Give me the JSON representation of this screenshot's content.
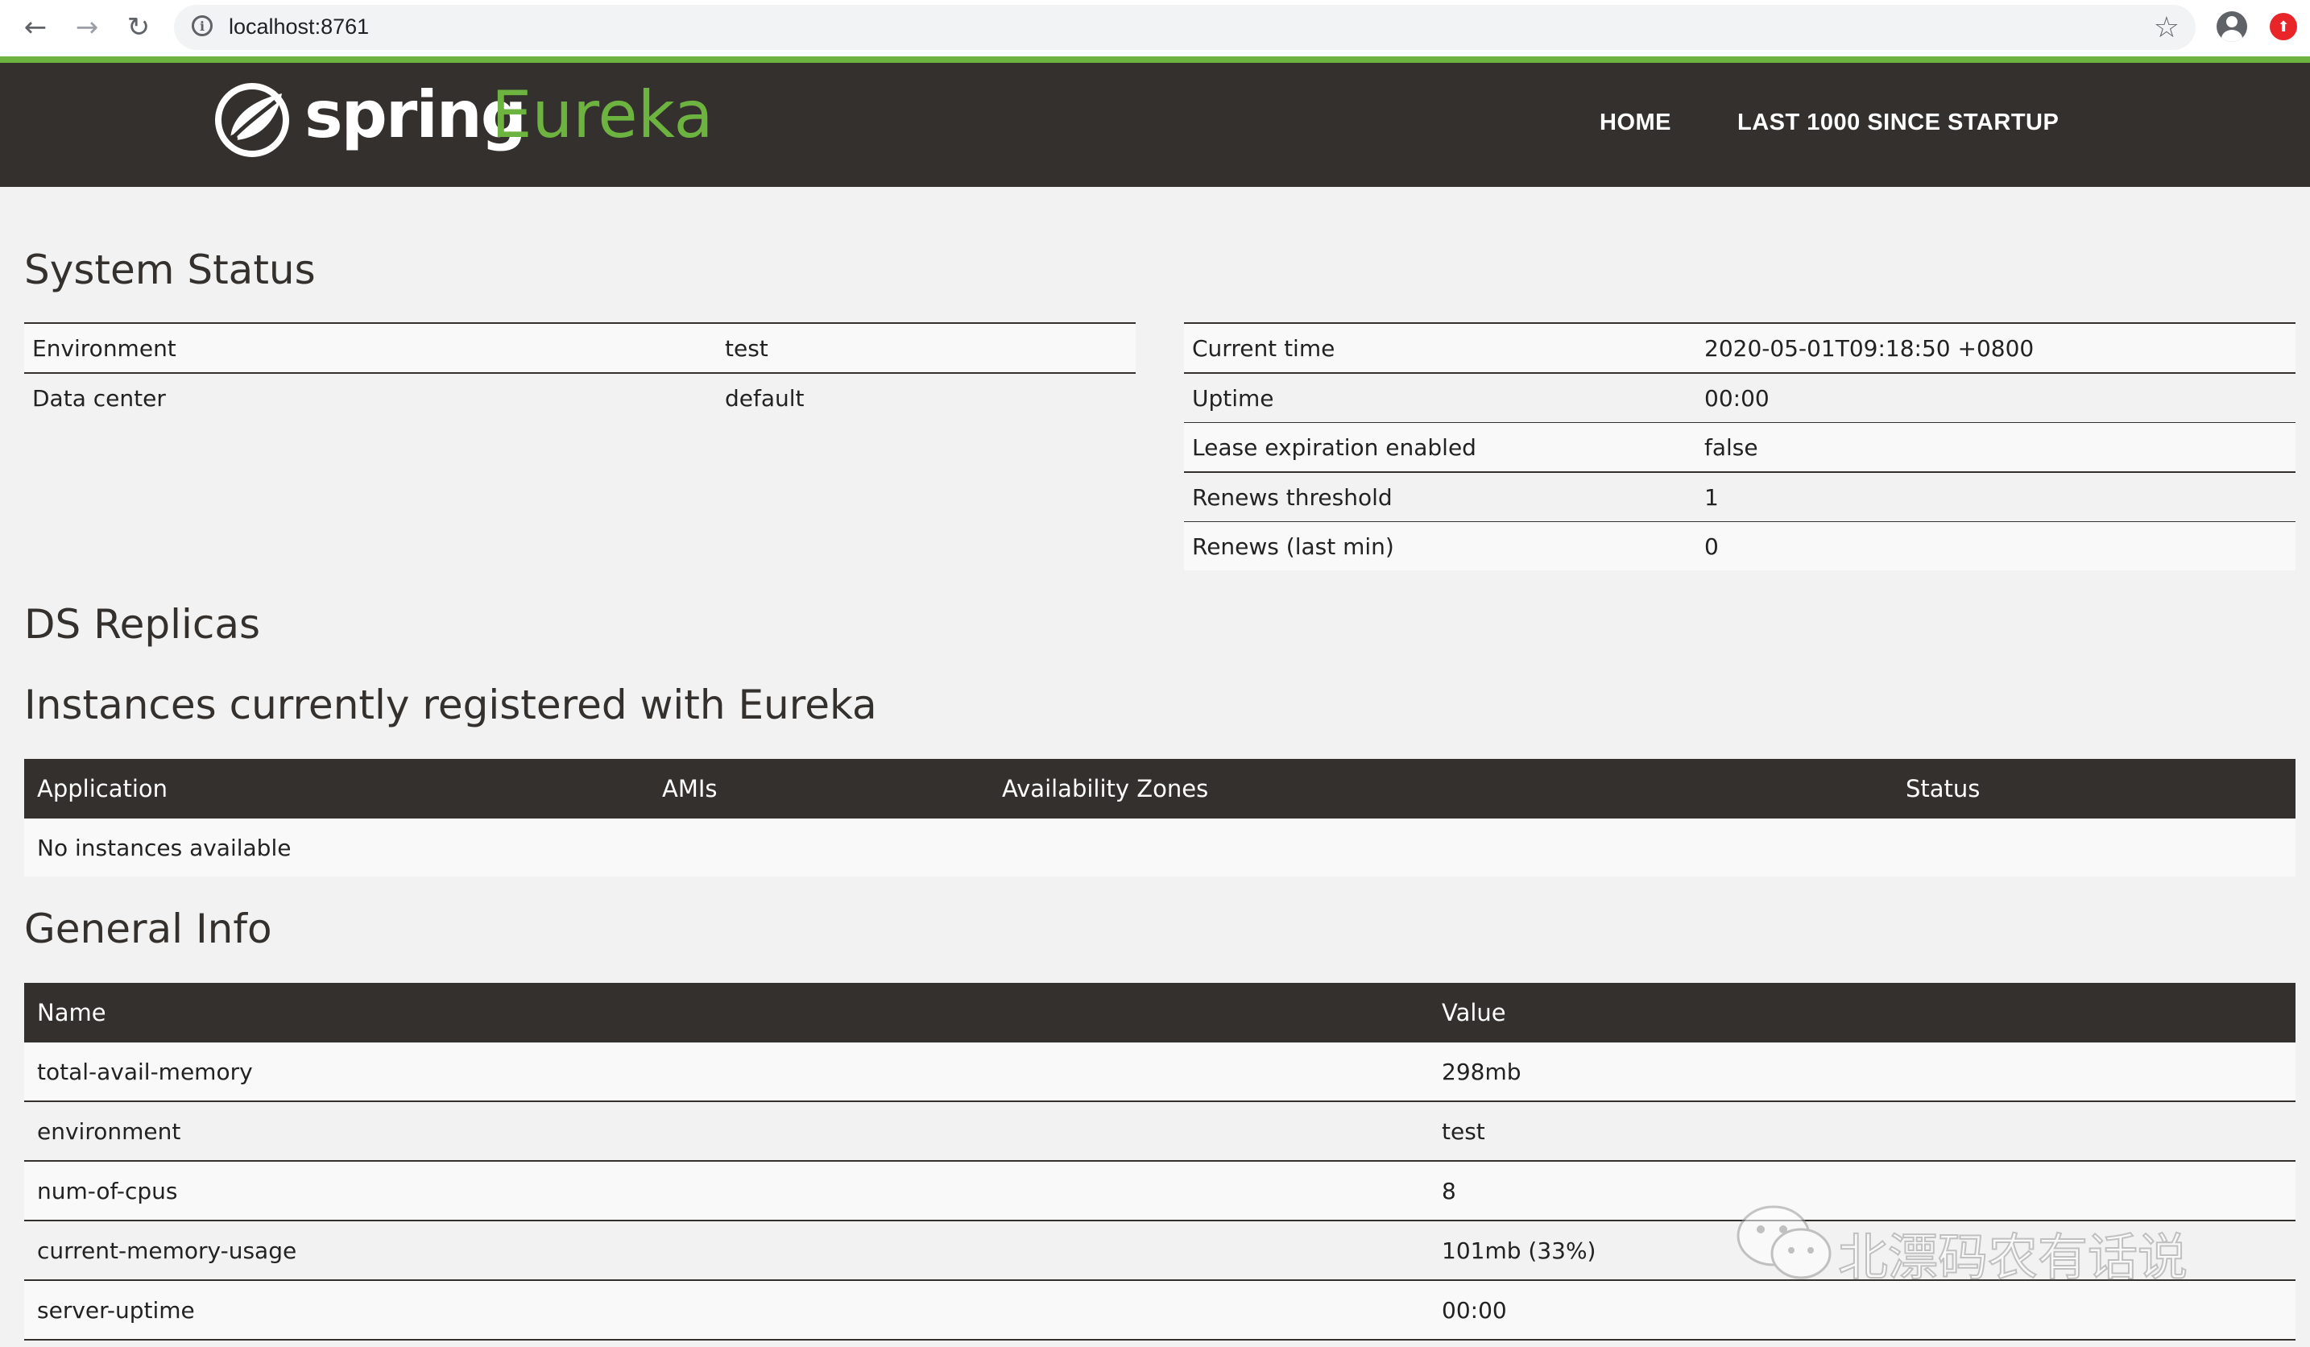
{
  "browser": {
    "url": "localhost:8761",
    "back_icon": "←",
    "forward_icon": "→",
    "reload_icon": "↻",
    "star_icon": "☆"
  },
  "header": {
    "logo_spring": "spring",
    "logo_eureka": "Eureka",
    "nav": [
      {
        "label": "HOME"
      },
      {
        "label": "LAST 1000 SINCE STARTUP"
      }
    ]
  },
  "system_status": {
    "title": "System Status",
    "left": [
      {
        "key": "Environment",
        "value": "test"
      },
      {
        "key": "Data center",
        "value": "default"
      }
    ],
    "right": [
      {
        "key": "Current time",
        "value": "2020-05-01T09:18:50 +0800"
      },
      {
        "key": "Uptime",
        "value": "00:00"
      },
      {
        "key": "Lease expiration enabled",
        "value": "false"
      },
      {
        "key": "Renews threshold",
        "value": "1"
      },
      {
        "key": "Renews (last min)",
        "value": "0"
      }
    ]
  },
  "ds_replicas": {
    "title": "DS Replicas"
  },
  "instances": {
    "title": "Instances currently registered with Eureka",
    "headers": [
      "Application",
      "AMIs",
      "Availability Zones",
      "Status"
    ],
    "empty_text": "No instances available"
  },
  "general_info": {
    "title": "General Info",
    "headers": [
      "Name",
      "Value"
    ],
    "rows": [
      {
        "name": "total-avail-memory",
        "value": "298mb"
      },
      {
        "name": "environment",
        "value": "test"
      },
      {
        "name": "num-of-cpus",
        "value": "8"
      },
      {
        "name": "current-memory-usage",
        "value": "101mb (33%)"
      },
      {
        "name": "server-uptime",
        "value": "00:00"
      }
    ]
  },
  "watermark": {
    "text": "北漂码农有话说"
  },
  "colors": {
    "header_bg": "#34302d",
    "accent_green": "#6db33f",
    "page_bg": "#f2f2f2"
  }
}
